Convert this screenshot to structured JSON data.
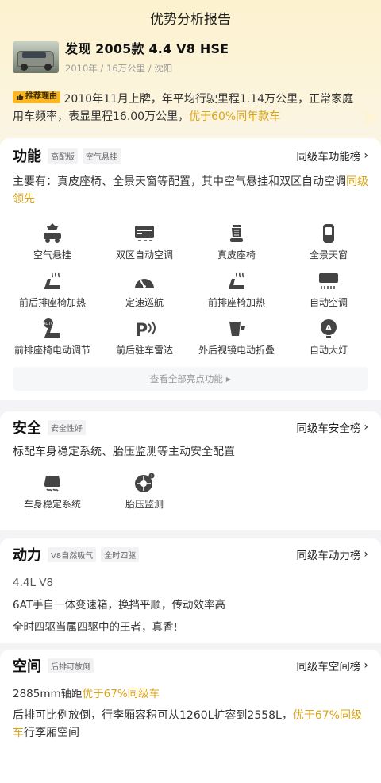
{
  "header": {
    "title": "优势分析报告"
  },
  "car": {
    "name": "发现 2005款 4.4 V8 HSE",
    "subtitle": "2010年 / 16万公里 / 沈阳"
  },
  "recommend": {
    "badge": "推荐理由",
    "text": "2010年11月上牌，年平均行驶里程1.14万公里，正常家庭用车频率，表显里程16.00万公里，",
    "highlight": "优于60%同年款车"
  },
  "function": {
    "title": "功能",
    "tags": [
      "高配版",
      "空气悬挂"
    ],
    "rank": "同级车功能榜",
    "desc": "主要有：真皮座椅、全景天窗等配置，其中空气悬挂和双区自动空调",
    "desc_highlight": "同级领先",
    "features": [
      {
        "icon": "air-suspension-icon",
        "label": "空气悬挂"
      },
      {
        "icon": "dual-zone-ac-icon",
        "label": "双区自动空调"
      },
      {
        "icon": "leather-seat-icon",
        "label": "真皮座椅"
      },
      {
        "icon": "panoramic-sunroof-icon",
        "label": "全景天窗"
      },
      {
        "icon": "seat-heating-icon",
        "label": "前后排座椅加热"
      },
      {
        "icon": "cruise-control-icon",
        "label": "定速巡航"
      },
      {
        "icon": "seat-heating-icon",
        "label": "前排座椅加热"
      },
      {
        "icon": "auto-ac-icon",
        "label": "自动空调"
      },
      {
        "icon": "power-seat-icon",
        "label": "前排座椅电动调节"
      },
      {
        "icon": "parking-radar-icon",
        "label": "前后驻车雷达"
      },
      {
        "icon": "mirror-fold-icon",
        "label": "外后视镜电动折叠"
      },
      {
        "icon": "auto-headlight-icon",
        "label": "自动大灯"
      }
    ],
    "more": "查看全部亮点功能"
  },
  "safety": {
    "title": "安全",
    "tags": [
      "安全性好"
    ],
    "rank": "同级车安全榜",
    "desc": "标配车身稳定系统、胎压监测等主动安全配置",
    "features": [
      {
        "icon": "stability-control-icon",
        "label": "车身稳定系统"
      },
      {
        "icon": "tire-pressure-icon",
        "label": "胎压监测"
      }
    ]
  },
  "power": {
    "title": "动力",
    "tags": [
      "V8自然吸气",
      "全时四驱"
    ],
    "rank": "同级车动力榜",
    "lines": [
      "4.4L V8",
      "6AT手自一体变速箱，换挡平顺，传动效率高",
      "全时四驱当属四驱中的王者，真香!"
    ]
  },
  "space": {
    "title": "空间",
    "tags": [
      "后排可放倒"
    ],
    "rank": "同级车空间榜",
    "line1": "2885mm轴距",
    "line1_highlight": "优于67%同级车",
    "line2": "后排可比例放倒，行李厢容积可从1260L扩容到2558L，",
    "line2_highlight": "优于67%同级车",
    "line2_tail": "行李厢空间"
  },
  "colors": {
    "accent": "#d9a416",
    "badge": "#fcb71e"
  }
}
